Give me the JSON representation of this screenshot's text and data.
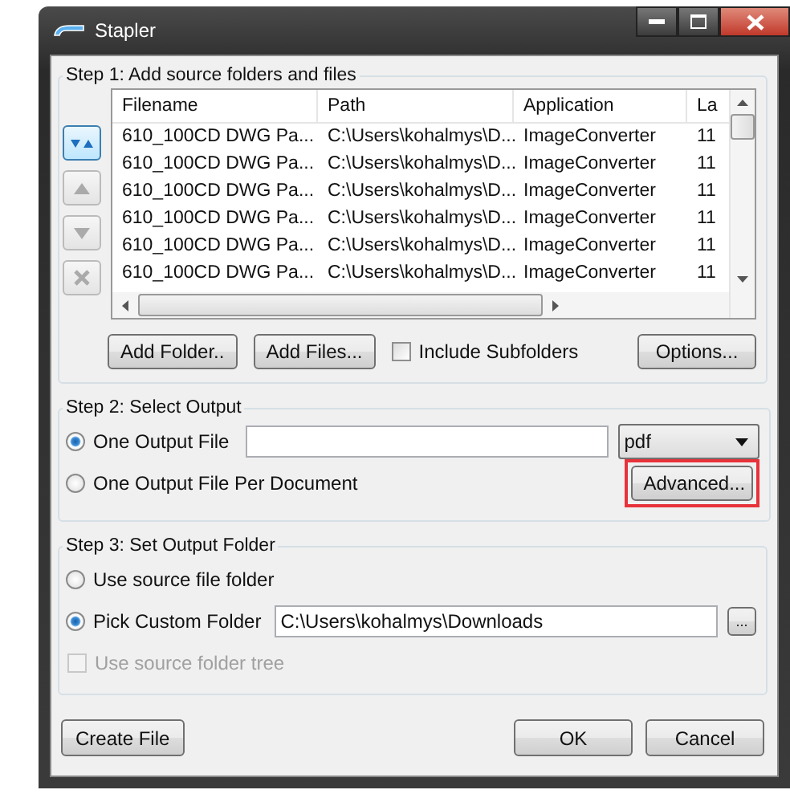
{
  "window": {
    "title": "Stapler"
  },
  "step1": {
    "title": "Step 1: Add source folders and files",
    "side_buttons": [
      {
        "kind": "updown",
        "disabled": false
      },
      {
        "kind": "up",
        "disabled": true
      },
      {
        "kind": "down",
        "disabled": true
      },
      {
        "kind": "remove",
        "disabled": true
      }
    ],
    "table": {
      "columns": [
        "Filename",
        "Path",
        "Application",
        "La"
      ],
      "rows": [
        [
          "610_100CD DWG Pa...",
          "C:\\Users\\kohalmys\\D...",
          "ImageConverter",
          "11"
        ],
        [
          "610_100CD DWG Pa...",
          "C:\\Users\\kohalmys\\D...",
          "ImageConverter",
          "11"
        ],
        [
          "610_100CD DWG Pa...",
          "C:\\Users\\kohalmys\\D...",
          "ImageConverter",
          "11"
        ],
        [
          "610_100CD DWG Pa...",
          "C:\\Users\\kohalmys\\D...",
          "ImageConverter",
          "11"
        ],
        [
          "610_100CD DWG Pa...",
          "C:\\Users\\kohalmys\\D...",
          "ImageConverter",
          "11"
        ],
        [
          "610_100CD DWG Pa...",
          "C:\\Users\\kohalmys\\D...",
          "ImageConverter",
          "11"
        ]
      ]
    },
    "add_folder": "Add Folder..",
    "add_files": "Add Files...",
    "include_subfolders": {
      "label": "Include Subfolders",
      "checked": false
    },
    "options": "Options..."
  },
  "step2": {
    "title": "Step 2: Select Output",
    "options": [
      {
        "label": "One Output File",
        "selected": true
      },
      {
        "label": "One Output File Per Document",
        "selected": false
      }
    ],
    "format": "pdf",
    "advanced": {
      "label": "Advanced...",
      "highlighted": true
    }
  },
  "step3": {
    "title": "Step 3: Set Output Folder",
    "options": [
      {
        "label": "Use source file folder",
        "selected": false
      },
      {
        "label": "Pick Custom Folder",
        "selected": true
      }
    ],
    "folder": "C:\\Users\\kohalmys\\Downloads",
    "browse": "...",
    "source_tree": {
      "label": "Use source folder tree",
      "checked": false,
      "disabled": true
    }
  },
  "buttons": {
    "create": "Create File",
    "ok": "OK",
    "cancel": "Cancel"
  }
}
